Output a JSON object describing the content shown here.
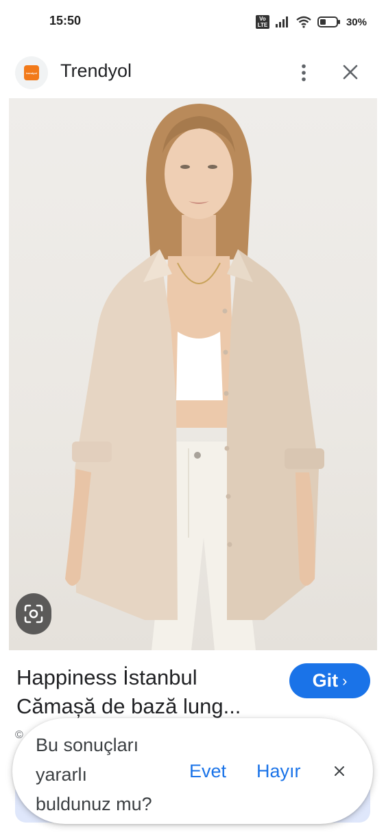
{
  "status_bar": {
    "time": "15:50",
    "network_badge": "Vo LTE",
    "battery": "30%"
  },
  "header": {
    "logo_text": "trendyol",
    "title": "Trendyol",
    "more_icon": "more-vert-icon",
    "close_icon": "close-icon"
  },
  "image": {
    "lens_icon": "google-lens-icon"
  },
  "product": {
    "title_line1": "Happiness İstanbul",
    "title_line2": "Cămașă de bază lung...",
    "visit_label": "Git",
    "visit_chevron": "›",
    "source_icon_char": "©"
  },
  "feedback": {
    "question_line1": "Bu sonuçları",
    "question_line2": "yararlı",
    "question_line3": "buldunuz mu?",
    "yes_label": "Evet",
    "no_label": "Hayır",
    "dismiss_icon": "close-icon"
  },
  "colors": {
    "accent": "#1a73e8",
    "brand": "#f27a1a"
  }
}
